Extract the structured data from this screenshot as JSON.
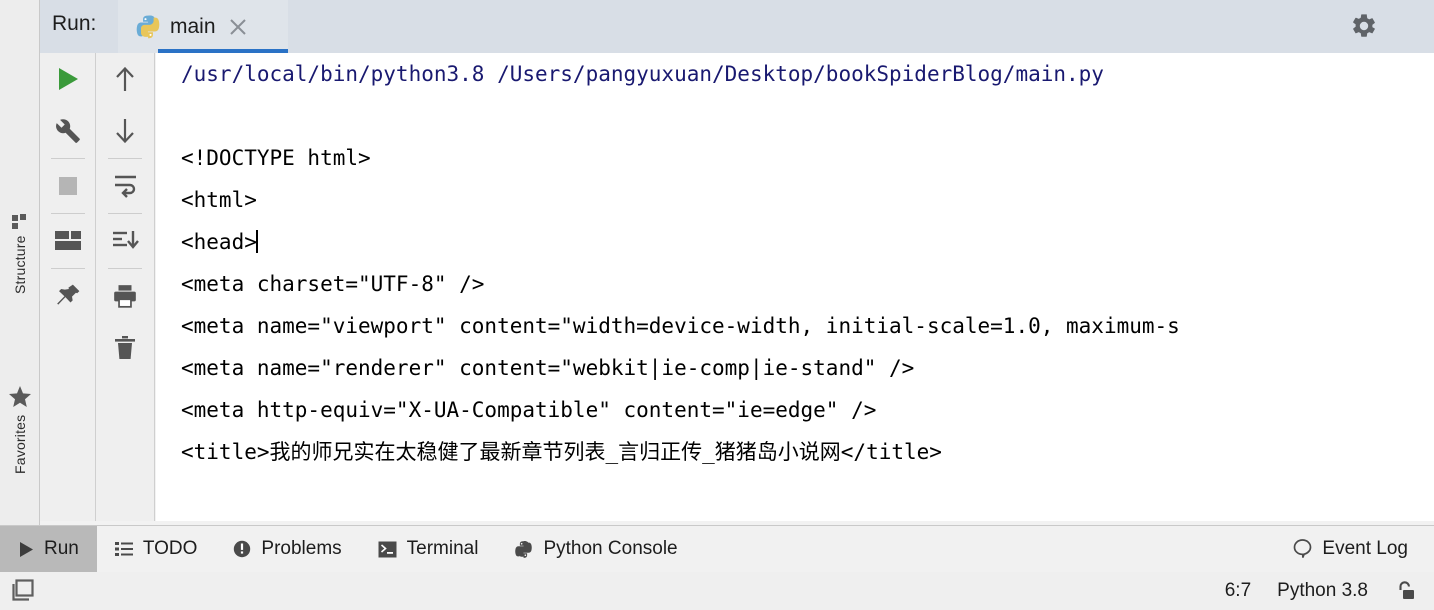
{
  "window": {
    "run_label": "Run:",
    "tab_label": "main",
    "tab_icon": "python-icon",
    "close_icon": "close-icon",
    "gear_icon": "gear-icon",
    "minimize_icon": "minimize-icon",
    "accent_color": "#2a72c6",
    "header_bg": "#d8dee6"
  },
  "left_stripe": {
    "items": [
      {
        "label": "Structure",
        "icon": "structure-icon"
      },
      {
        "label": "Favorites",
        "icon": "star-icon"
      }
    ]
  },
  "toolbar_primary": {
    "buttons": [
      {
        "name": "rerun-button",
        "icon": "play-icon",
        "color": "#3a9a3a"
      },
      {
        "name": "settings-button",
        "icon": "wrench-icon"
      },
      {
        "name": "stop-button",
        "icon": "stop-square-icon",
        "color": "#b5b5b5"
      },
      {
        "name": "restore-layout-button",
        "icon": "layout-icon"
      },
      {
        "name": "pin-tab-button",
        "icon": "pin-icon"
      }
    ]
  },
  "toolbar_secondary": {
    "buttons": [
      {
        "name": "up-button",
        "icon": "arrow-up-icon"
      },
      {
        "name": "down-button",
        "icon": "arrow-down-icon"
      },
      {
        "name": "soft-wrap-button",
        "icon": "soft-wrap-icon"
      },
      {
        "name": "scroll-to-end-button",
        "icon": "scroll-to-end-icon"
      },
      {
        "name": "print-button",
        "icon": "print-icon"
      },
      {
        "name": "clear-all-button",
        "icon": "trash-icon"
      }
    ]
  },
  "console": {
    "command_line": "/usr/local/bin/python3.8 /Users/pangyuxuan/Desktop/bookSpiderBlog/main.py",
    "lines": [
      "<!DOCTYPE html>",
      "<html>",
      "<head>",
      "<meta charset=\"UTF-8\" />",
      "<meta name=\"viewport\" content=\"width=device-width, initial-scale=1.0, maximum-s",
      "<meta name=\"renderer\" content=\"webkit|ie-comp|ie-stand\" />",
      "<meta http-equiv=\"X-UA-Compatible\" content=\"ie=edge\" />",
      "<title>我的师兄实在太稳健了最新章节列表_言归正传_猪猪岛小说网</title>"
    ],
    "caret_line_index": 2,
    "text_color": "#000000",
    "command_color": "#191970"
  },
  "bottom_bar": {
    "tabs": [
      {
        "label": "Run",
        "icon": "play-icon",
        "active": true
      },
      {
        "label": "TODO",
        "icon": "todo-list-icon",
        "active": false
      },
      {
        "label": "Problems",
        "icon": "problems-icon",
        "active": false
      },
      {
        "label": "Terminal",
        "icon": "terminal-icon",
        "active": false
      },
      {
        "label": "Python Console",
        "icon": "python-icon",
        "active": false
      }
    ],
    "right_tab": {
      "label": "Event Log",
      "icon": "event-log-icon"
    }
  },
  "status_bar": {
    "layout_icon": "tool-windows-icon",
    "caret_position": "6:7",
    "interpreter": "Python 3.8",
    "lock_icon": "unlocked-padlock-icon"
  }
}
